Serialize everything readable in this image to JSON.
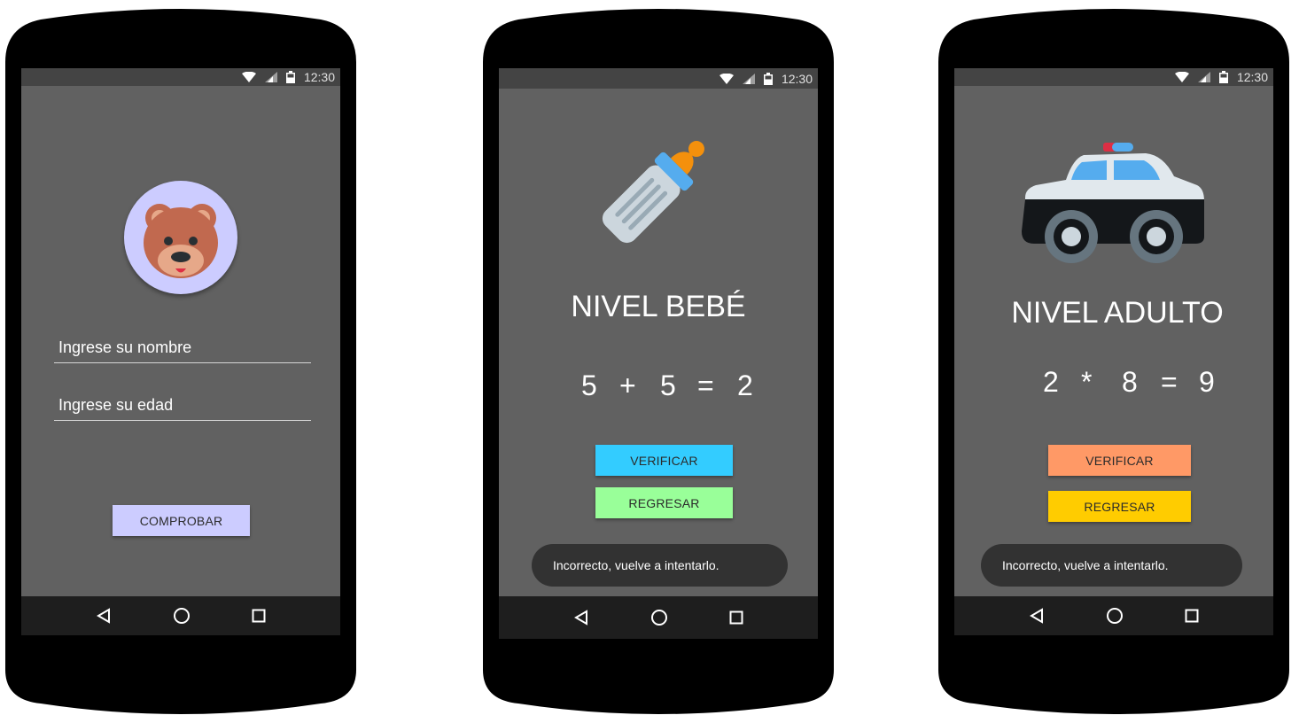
{
  "status_bar": {
    "time": "12:30"
  },
  "screen1": {
    "name_placeholder": "Ingrese su nombre",
    "age_placeholder": "Ingrese su edad",
    "check_button": "COMPROBAR",
    "avatar_icon": "bear-face-icon",
    "colors": {
      "avatar_bg": "#ccccff",
      "button": "#ccccff"
    }
  },
  "screen2": {
    "title": "NIVEL BEBÉ",
    "equation": {
      "a": "5",
      "op": "+",
      "b": "5",
      "eq": "=",
      "answer": "2"
    },
    "verify_button": "VERIFICAR",
    "back_button": "REGRESAR",
    "toast": "Incorrecto, vuelve a intentarlo.",
    "level_icon": "baby-bottle-icon",
    "colors": {
      "verify": "#33ccff",
      "back": "#99ff99"
    }
  },
  "screen3": {
    "title": "NIVEL ADULTO",
    "equation": {
      "a": "2",
      "op": "*",
      "b": "8",
      "eq": "=",
      "answer": "9"
    },
    "verify_button": "VERIFICAR",
    "back_button": "REGRESAR",
    "toast": "Incorrecto, vuelve a intentarlo.",
    "level_icon": "police-car-icon",
    "colors": {
      "verify": "#ff9966",
      "back": "#ffcc00"
    }
  },
  "nav": {
    "back_icon": "back-triangle-icon",
    "home_icon": "home-circle-icon",
    "recents_icon": "recents-square-icon"
  }
}
